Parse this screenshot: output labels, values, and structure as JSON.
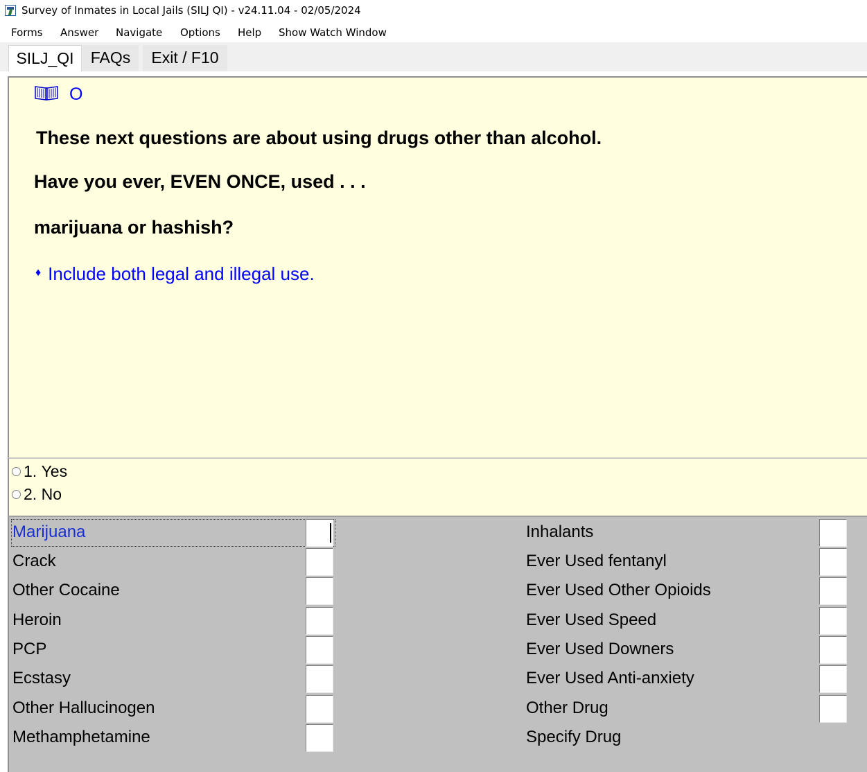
{
  "window": {
    "title": "Survey of Inmates in Local Jails (SILJ QI) - v24.11.04 - 02/05/2024"
  },
  "menu": [
    "Forms",
    "Answer",
    "Navigate",
    "Options",
    "Help",
    "Show Watch Window"
  ],
  "tabs": [
    "SILJ_QI",
    "FAQs",
    "Exit / F10"
  ],
  "question": {
    "icon": "book-icon",
    "marker": "O",
    "intro": "These next questions are about using drugs other than alcohol.",
    "stem": "Have you ever, EVEN ONCE, used . . .",
    "item": "marijuana or hashish?",
    "instruction": "Include both legal and illegal use.",
    "accent_color": "#0000ff",
    "background_color": "#ffffe0"
  },
  "answers": [
    {
      "num": "1.",
      "label": "Yes",
      "selected": false
    },
    {
      "num": "2.",
      "label": "No",
      "selected": false
    }
  ],
  "grid": {
    "left": [
      {
        "label": "Marijuana",
        "value": "",
        "current": true
      },
      {
        "label": "Crack",
        "value": ""
      },
      {
        "label": "Other Cocaine",
        "value": ""
      },
      {
        "label": "Heroin",
        "value": ""
      },
      {
        "label": "PCP",
        "value": ""
      },
      {
        "label": "Ecstasy",
        "value": ""
      },
      {
        "label": "Other Hallucinogen",
        "value": ""
      },
      {
        "label": "Methamphetamine",
        "value": ""
      }
    ],
    "right": [
      {
        "label": "Inhalants",
        "value": ""
      },
      {
        "label": "Ever Used fentanyl",
        "value": ""
      },
      {
        "label": "Ever Used Other Opioids",
        "value": ""
      },
      {
        "label": "Ever Used Speed",
        "value": ""
      },
      {
        "label": "Ever Used Downers",
        "value": ""
      },
      {
        "label": "Ever Used Anti-anxiety",
        "value": ""
      },
      {
        "label": "Other Drug",
        "value": ""
      },
      {
        "label": "Specify Drug",
        "value": ""
      }
    ],
    "current_label_color": "#1a2fd0",
    "panel_color": "#c0c0c0"
  }
}
